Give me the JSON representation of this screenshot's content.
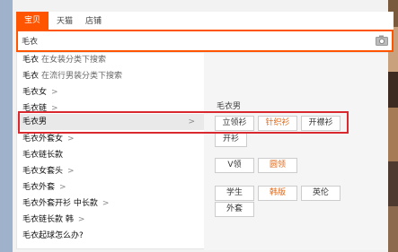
{
  "tabs": [
    "宝贝",
    "天猫",
    "店铺"
  ],
  "search": {
    "value": "毛衣",
    "placeholder": ""
  },
  "suggestions": [
    {
      "query": "毛衣",
      "hint": "在女装分类下搜索",
      "arrow": false
    },
    {
      "query": "毛衣",
      "hint": "在流行男装分类下搜索",
      "arrow": false
    },
    {
      "query": "毛衣女",
      "hint": "",
      "arrow": true
    },
    {
      "query": "毛衣链",
      "hint": "",
      "arrow": true
    },
    {
      "query": "毛衣男",
      "hint": "",
      "arrow": false,
      "highlight": true
    },
    {
      "query": "毛衣外套女",
      "hint": "",
      "arrow": true
    },
    {
      "query": "毛衣链长款",
      "hint": "",
      "arrow": false
    },
    {
      "query": "毛衣女套头",
      "hint": "",
      "arrow": true
    },
    {
      "query": "毛衣外套",
      "hint": "",
      "arrow": true
    },
    {
      "query": "毛衣外套开衫 中长款",
      "hint": "",
      "arrow": true
    },
    {
      "query": "毛衣链长款 韩",
      "hint": "",
      "arrow": true
    },
    {
      "query": "毛衣起球怎么办?",
      "hint": "",
      "arrow": false
    }
  ],
  "panel": {
    "title": "毛衣男",
    "group1": [
      "立领衫",
      "针织衫",
      "开襟衫",
      "开衫"
    ],
    "group2": [
      "V领",
      "圆领"
    ],
    "group3": [
      "学生",
      "韩版",
      "英伦",
      "外套"
    ]
  },
  "colors": {
    "accent": "#ff5500",
    "outline": "#d9282e",
    "orange_text": "#e06a1b"
  },
  "icons": {
    "camera": "camera-icon",
    "arrow": "chevron-right-icon"
  }
}
